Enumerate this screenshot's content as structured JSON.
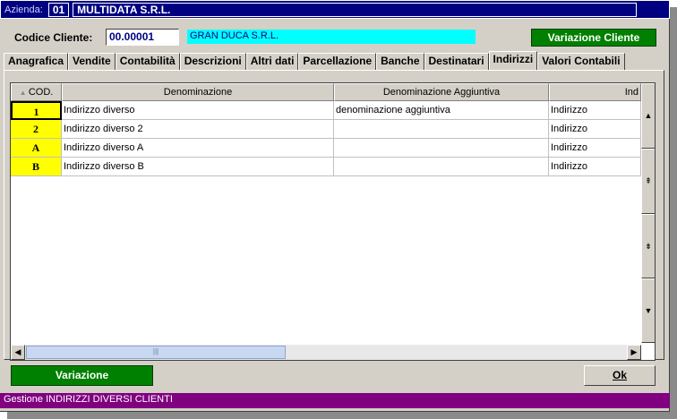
{
  "titlebar": {
    "label": "Azienda:",
    "code": "01",
    "name": "MULTIDATA S.R.L."
  },
  "client": {
    "label": "Codice Cliente:",
    "code": "00.00001",
    "name": "GRAN DUCA S.R.L.",
    "change_button": "Variazione Cliente"
  },
  "tabs": [
    {
      "label": "Anagrafica"
    },
    {
      "label": "Vendite"
    },
    {
      "label": "Contabilità"
    },
    {
      "label": "Descrizioni"
    },
    {
      "label": "Altri dati"
    },
    {
      "label": "Parcellazione"
    },
    {
      "label": "Banche"
    },
    {
      "label": "Destinatari"
    },
    {
      "label": "Indirizzi"
    },
    {
      "label": "Valori Contabili"
    }
  ],
  "active_tab": "Indirizzi",
  "grid": {
    "headers": {
      "cod": "COD.",
      "denominazione": "Denominazione",
      "aggiuntiva": "Denominazione Aggiuntiva",
      "indirizzo": "Ind"
    },
    "rows": [
      {
        "cod": "1",
        "denominazione": "Indirizzo diverso",
        "aggiuntiva": "denominazione aggiuntiva",
        "indirizzo": "Indirizzo"
      },
      {
        "cod": "2",
        "denominazione": "Indirizzo diverso 2",
        "aggiuntiva": "",
        "indirizzo": "Indirizzo"
      },
      {
        "cod": "A",
        "denominazione": "Indirizzo diverso A",
        "aggiuntiva": "",
        "indirizzo": "Indirizzo"
      },
      {
        "cod": "B",
        "denominazione": "Indirizzo diverso B",
        "aggiuntiva": "",
        "indirizzo": "Indirizzo"
      }
    ]
  },
  "buttons": {
    "variazione": "Variazione",
    "ok": "Ok"
  },
  "status": "Gestione INDIRIZZI DIVERSI CLIENTI",
  "colors": {
    "title_bg": "#000080",
    "status_bg": "#800080",
    "green_button": "#008000",
    "cod_cell": "#ffff00",
    "client_name_bg": "#00ffff"
  }
}
